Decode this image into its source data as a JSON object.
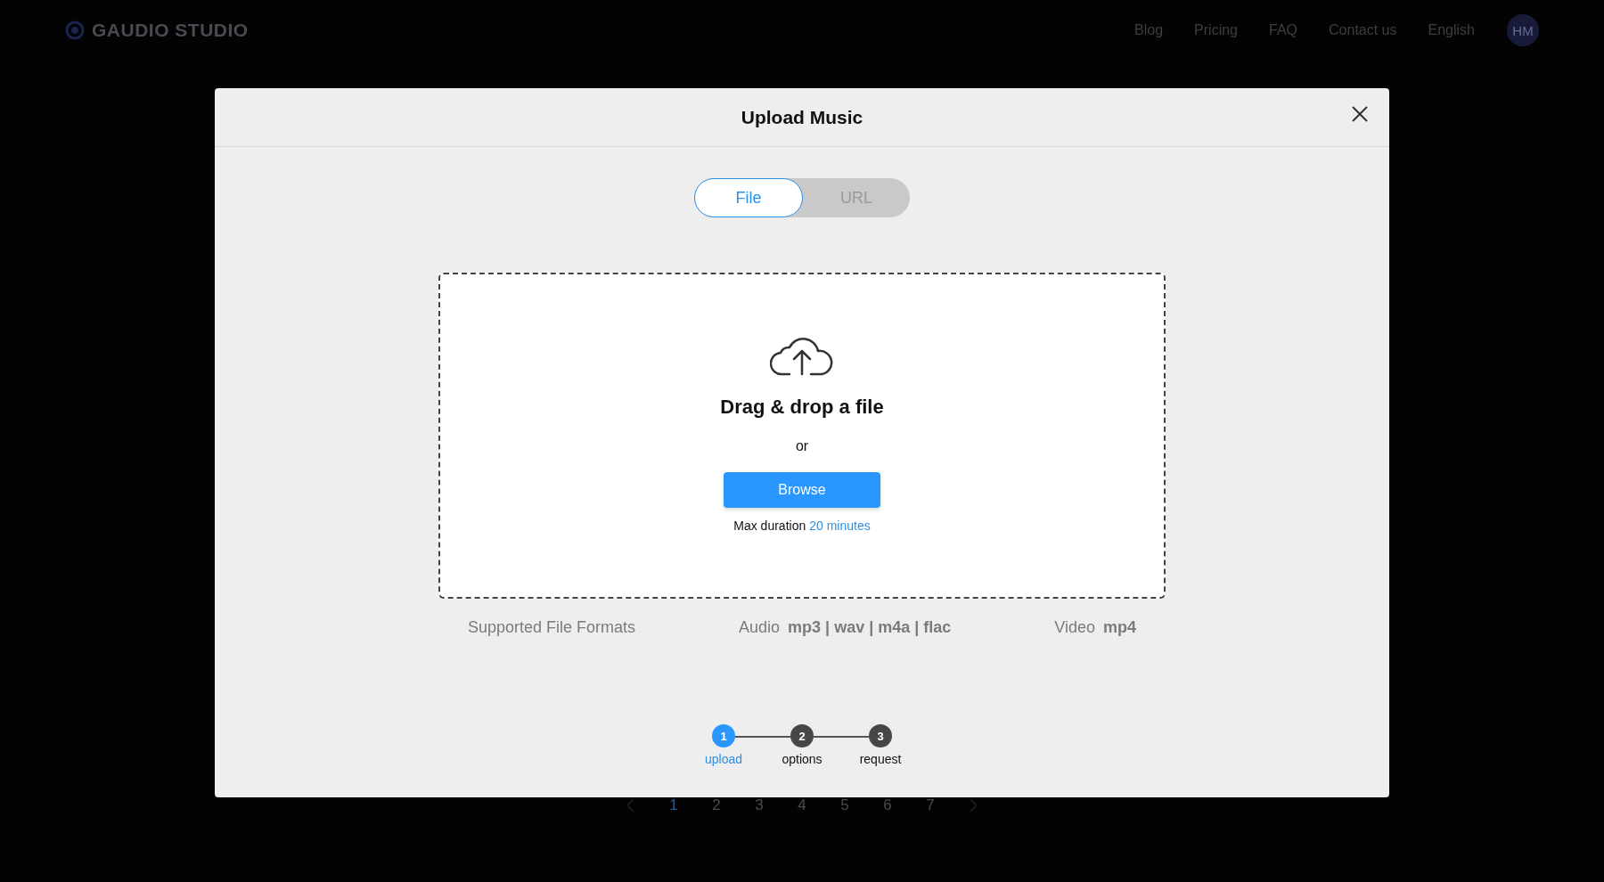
{
  "header": {
    "logo": "GAUDIO STUDIO",
    "nav": [
      "Blog",
      "Pricing",
      "FAQ",
      "Contact us",
      "English"
    ],
    "avatar": "HM"
  },
  "pagination": {
    "pages": [
      {
        "label": "1",
        "selected": true
      },
      {
        "label": "2",
        "selected": false
      },
      {
        "label": "3",
        "selected": false
      },
      {
        "label": "4",
        "selected": false
      },
      {
        "label": "5",
        "selected": false
      },
      {
        "label": "6",
        "selected": false
      },
      {
        "label": "7",
        "selected": false
      }
    ]
  },
  "modal": {
    "title": "Upload Music",
    "source_tabs": [
      {
        "label": "File",
        "selected": true
      },
      {
        "label": "URL",
        "selected": false
      }
    ],
    "dropzone": {
      "heading": "Drag & drop a file",
      "or": "or",
      "button": "Browse",
      "limit_label": "Max duration",
      "limit_value": "20 minutes"
    },
    "formats": {
      "title": "Supported File Formats",
      "groups": [
        {
          "label": "Audio",
          "types": "mp3 | wav | m4a | flac"
        },
        {
          "label": "Video",
          "types": "mp4"
        }
      ]
    },
    "steps": [
      {
        "number": "1",
        "label": "upload",
        "selected": true
      },
      {
        "number": "2",
        "label": "options",
        "selected": false
      },
      {
        "number": "3",
        "label": "request",
        "selected": false
      }
    ]
  }
}
